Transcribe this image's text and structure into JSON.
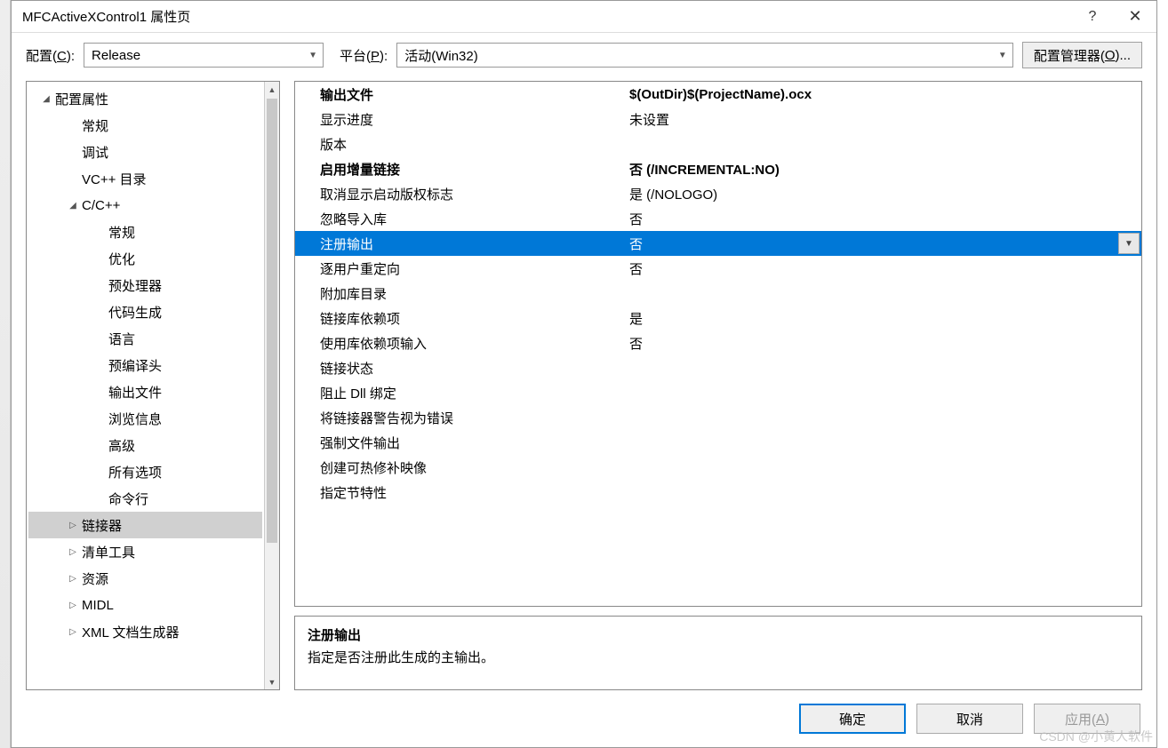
{
  "titlebar": {
    "title": "MFCActiveXControl1 属性页",
    "help_icon": "?",
    "close_icon": "✕"
  },
  "config_row": {
    "config_label": "配置(C):",
    "config_value": "Release",
    "platform_label": "平台(P):",
    "platform_value": "活动(Win32)",
    "config_mgr": "配置管理器(O)..."
  },
  "tree": {
    "items": [
      {
        "label": "配置属性",
        "indent": 0,
        "toggle": "▼"
      },
      {
        "label": "常规",
        "indent": 1,
        "toggle": ""
      },
      {
        "label": "调试",
        "indent": 1,
        "toggle": ""
      },
      {
        "label": "VC++ 目录",
        "indent": 1,
        "toggle": ""
      },
      {
        "label": "C/C++",
        "indent": 1,
        "toggle": "▼"
      },
      {
        "label": "常规",
        "indent": 2,
        "toggle": ""
      },
      {
        "label": "优化",
        "indent": 2,
        "toggle": ""
      },
      {
        "label": "预处理器",
        "indent": 2,
        "toggle": ""
      },
      {
        "label": "代码生成",
        "indent": 2,
        "toggle": ""
      },
      {
        "label": "语言",
        "indent": 2,
        "toggle": ""
      },
      {
        "label": "预编译头",
        "indent": 2,
        "toggle": ""
      },
      {
        "label": "输出文件",
        "indent": 2,
        "toggle": ""
      },
      {
        "label": "浏览信息",
        "indent": 2,
        "toggle": ""
      },
      {
        "label": "高级",
        "indent": 2,
        "toggle": ""
      },
      {
        "label": "所有选项",
        "indent": 2,
        "toggle": ""
      },
      {
        "label": "命令行",
        "indent": 2,
        "toggle": ""
      },
      {
        "label": "链接器",
        "indent": 1,
        "toggle": "▶",
        "selected": true
      },
      {
        "label": "清单工具",
        "indent": 1,
        "toggle": "▶"
      },
      {
        "label": "资源",
        "indent": 1,
        "toggle": "▶"
      },
      {
        "label": "MIDL",
        "indent": 1,
        "toggle": "▶"
      },
      {
        "label": "XML 文档生成器",
        "indent": 1,
        "toggle": "▶"
      }
    ]
  },
  "props": {
    "rows": [
      {
        "label": "输出文件",
        "value": "$(OutDir)$(ProjectName).ocx",
        "bold": true
      },
      {
        "label": "显示进度",
        "value": "未设置"
      },
      {
        "label": "版本",
        "value": ""
      },
      {
        "label": "启用增量链接",
        "value": "否 (/INCREMENTAL:NO)",
        "bold": true
      },
      {
        "label": "取消显示启动版权标志",
        "value": "是 (/NOLOGO)"
      },
      {
        "label": "忽略导入库",
        "value": "否"
      },
      {
        "label": "注册输出",
        "value": "否",
        "selected": true
      },
      {
        "label": "逐用户重定向",
        "value": "否"
      },
      {
        "label": "附加库目录",
        "value": ""
      },
      {
        "label": "链接库依赖项",
        "value": "是"
      },
      {
        "label": "使用库依赖项输入",
        "value": "否"
      },
      {
        "label": "链接状态",
        "value": ""
      },
      {
        "label": "阻止 Dll 绑定",
        "value": ""
      },
      {
        "label": "将链接器警告视为错误",
        "value": ""
      },
      {
        "label": "强制文件输出",
        "value": ""
      },
      {
        "label": "创建可热修补映像",
        "value": ""
      },
      {
        "label": "指定节特性",
        "value": ""
      }
    ]
  },
  "desc": {
    "title": "注册输出",
    "text": "指定是否注册此生成的主输出。"
  },
  "footer": {
    "ok": "确定",
    "cancel": "取消",
    "apply": "应用(A)"
  },
  "watermark": "CSDN @小黄人软件"
}
